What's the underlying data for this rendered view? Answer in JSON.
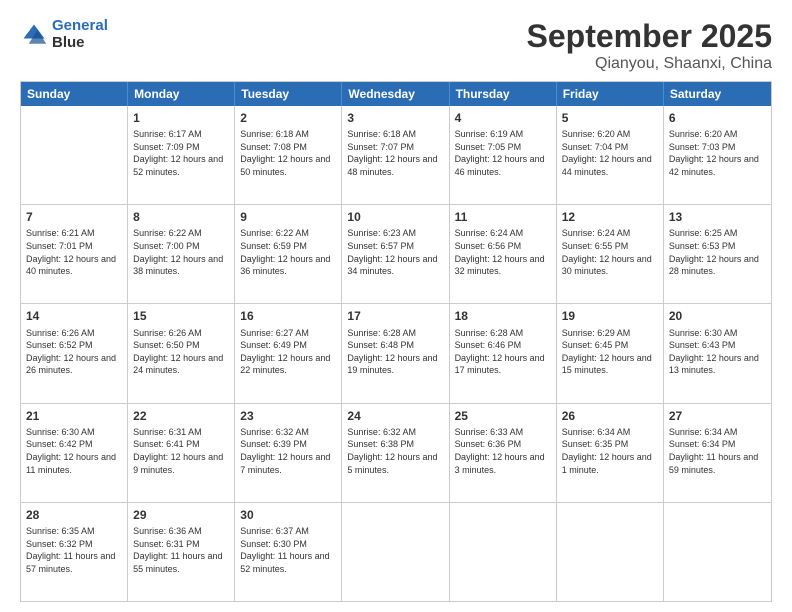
{
  "header": {
    "logo_line1": "General",
    "logo_line2": "Blue",
    "title": "September 2025",
    "subtitle": "Qianyou, Shaanxi, China"
  },
  "days_of_week": [
    "Sunday",
    "Monday",
    "Tuesday",
    "Wednesday",
    "Thursday",
    "Friday",
    "Saturday"
  ],
  "weeks": [
    [
      {
        "day": "",
        "empty": true
      },
      {
        "day": "1",
        "sunrise": "Sunrise: 6:17 AM",
        "sunset": "Sunset: 7:09 PM",
        "daylight": "Daylight: 12 hours and 52 minutes."
      },
      {
        "day": "2",
        "sunrise": "Sunrise: 6:18 AM",
        "sunset": "Sunset: 7:08 PM",
        "daylight": "Daylight: 12 hours and 50 minutes."
      },
      {
        "day": "3",
        "sunrise": "Sunrise: 6:18 AM",
        "sunset": "Sunset: 7:07 PM",
        "daylight": "Daylight: 12 hours and 48 minutes."
      },
      {
        "day": "4",
        "sunrise": "Sunrise: 6:19 AM",
        "sunset": "Sunset: 7:05 PM",
        "daylight": "Daylight: 12 hours and 46 minutes."
      },
      {
        "day": "5",
        "sunrise": "Sunrise: 6:20 AM",
        "sunset": "Sunset: 7:04 PM",
        "daylight": "Daylight: 12 hours and 44 minutes."
      },
      {
        "day": "6",
        "sunrise": "Sunrise: 6:20 AM",
        "sunset": "Sunset: 7:03 PM",
        "daylight": "Daylight: 12 hours and 42 minutes."
      }
    ],
    [
      {
        "day": "7",
        "sunrise": "Sunrise: 6:21 AM",
        "sunset": "Sunset: 7:01 PM",
        "daylight": "Daylight: 12 hours and 40 minutes."
      },
      {
        "day": "8",
        "sunrise": "Sunrise: 6:22 AM",
        "sunset": "Sunset: 7:00 PM",
        "daylight": "Daylight: 12 hours and 38 minutes."
      },
      {
        "day": "9",
        "sunrise": "Sunrise: 6:22 AM",
        "sunset": "Sunset: 6:59 PM",
        "daylight": "Daylight: 12 hours and 36 minutes."
      },
      {
        "day": "10",
        "sunrise": "Sunrise: 6:23 AM",
        "sunset": "Sunset: 6:57 PM",
        "daylight": "Daylight: 12 hours and 34 minutes."
      },
      {
        "day": "11",
        "sunrise": "Sunrise: 6:24 AM",
        "sunset": "Sunset: 6:56 PM",
        "daylight": "Daylight: 12 hours and 32 minutes."
      },
      {
        "day": "12",
        "sunrise": "Sunrise: 6:24 AM",
        "sunset": "Sunset: 6:55 PM",
        "daylight": "Daylight: 12 hours and 30 minutes."
      },
      {
        "day": "13",
        "sunrise": "Sunrise: 6:25 AM",
        "sunset": "Sunset: 6:53 PM",
        "daylight": "Daylight: 12 hours and 28 minutes."
      }
    ],
    [
      {
        "day": "14",
        "sunrise": "Sunrise: 6:26 AM",
        "sunset": "Sunset: 6:52 PM",
        "daylight": "Daylight: 12 hours and 26 minutes."
      },
      {
        "day": "15",
        "sunrise": "Sunrise: 6:26 AM",
        "sunset": "Sunset: 6:50 PM",
        "daylight": "Daylight: 12 hours and 24 minutes."
      },
      {
        "day": "16",
        "sunrise": "Sunrise: 6:27 AM",
        "sunset": "Sunset: 6:49 PM",
        "daylight": "Daylight: 12 hours and 22 minutes."
      },
      {
        "day": "17",
        "sunrise": "Sunrise: 6:28 AM",
        "sunset": "Sunset: 6:48 PM",
        "daylight": "Daylight: 12 hours and 19 minutes."
      },
      {
        "day": "18",
        "sunrise": "Sunrise: 6:28 AM",
        "sunset": "Sunset: 6:46 PM",
        "daylight": "Daylight: 12 hours and 17 minutes."
      },
      {
        "day": "19",
        "sunrise": "Sunrise: 6:29 AM",
        "sunset": "Sunset: 6:45 PM",
        "daylight": "Daylight: 12 hours and 15 minutes."
      },
      {
        "day": "20",
        "sunrise": "Sunrise: 6:30 AM",
        "sunset": "Sunset: 6:43 PM",
        "daylight": "Daylight: 12 hours and 13 minutes."
      }
    ],
    [
      {
        "day": "21",
        "sunrise": "Sunrise: 6:30 AM",
        "sunset": "Sunset: 6:42 PM",
        "daylight": "Daylight: 12 hours and 11 minutes."
      },
      {
        "day": "22",
        "sunrise": "Sunrise: 6:31 AM",
        "sunset": "Sunset: 6:41 PM",
        "daylight": "Daylight: 12 hours and 9 minutes."
      },
      {
        "day": "23",
        "sunrise": "Sunrise: 6:32 AM",
        "sunset": "Sunset: 6:39 PM",
        "daylight": "Daylight: 12 hours and 7 minutes."
      },
      {
        "day": "24",
        "sunrise": "Sunrise: 6:32 AM",
        "sunset": "Sunset: 6:38 PM",
        "daylight": "Daylight: 12 hours and 5 minutes."
      },
      {
        "day": "25",
        "sunrise": "Sunrise: 6:33 AM",
        "sunset": "Sunset: 6:36 PM",
        "daylight": "Daylight: 12 hours and 3 minutes."
      },
      {
        "day": "26",
        "sunrise": "Sunrise: 6:34 AM",
        "sunset": "Sunset: 6:35 PM",
        "daylight": "Daylight: 12 hours and 1 minute."
      },
      {
        "day": "27",
        "sunrise": "Sunrise: 6:34 AM",
        "sunset": "Sunset: 6:34 PM",
        "daylight": "Daylight: 11 hours and 59 minutes."
      }
    ],
    [
      {
        "day": "28",
        "sunrise": "Sunrise: 6:35 AM",
        "sunset": "Sunset: 6:32 PM",
        "daylight": "Daylight: 11 hours and 57 minutes."
      },
      {
        "day": "29",
        "sunrise": "Sunrise: 6:36 AM",
        "sunset": "Sunset: 6:31 PM",
        "daylight": "Daylight: 11 hours and 55 minutes."
      },
      {
        "day": "30",
        "sunrise": "Sunrise: 6:37 AM",
        "sunset": "Sunset: 6:30 PM",
        "daylight": "Daylight: 11 hours and 52 minutes."
      },
      {
        "day": "",
        "empty": true
      },
      {
        "day": "",
        "empty": true
      },
      {
        "day": "",
        "empty": true
      },
      {
        "day": "",
        "empty": true
      }
    ]
  ]
}
